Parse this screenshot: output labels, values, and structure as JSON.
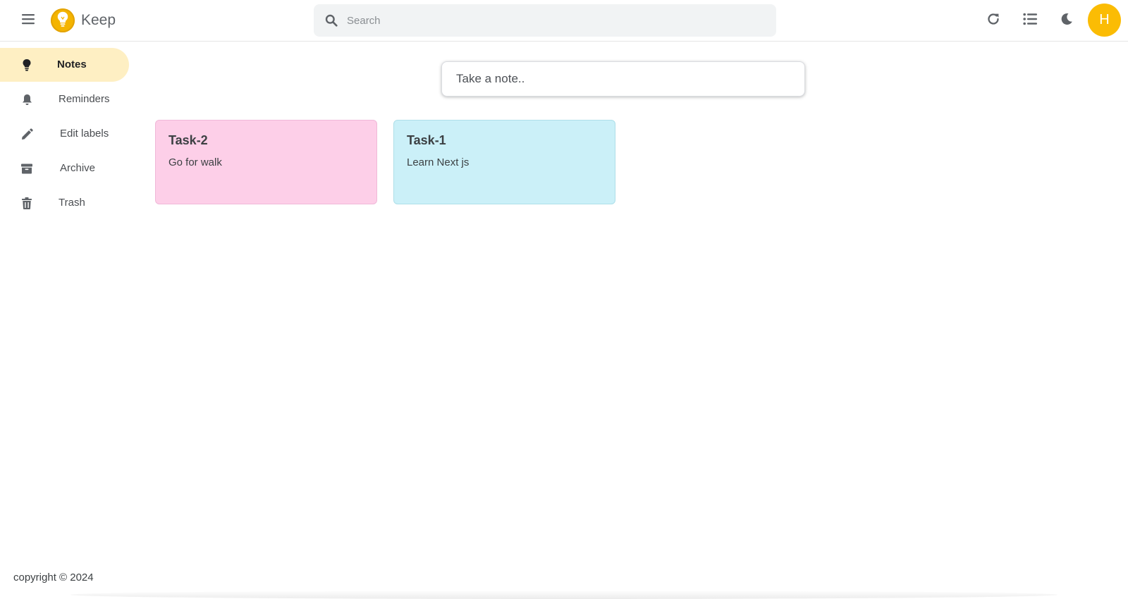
{
  "header": {
    "app_title": "Keep",
    "search_placeholder": "Search",
    "search_value": "",
    "avatar_initial": "H",
    "icons": [
      "hamburger-menu-icon",
      "bulb-logo-icon",
      "search-icon",
      "refresh-icon",
      "list-view-icon",
      "dark-mode-icon"
    ]
  },
  "sidebar": {
    "items": [
      {
        "label": "Notes",
        "icon": "bulb-icon",
        "active": true
      },
      {
        "label": "Reminders",
        "icon": "bell-icon",
        "active": false
      },
      {
        "label": "Edit labels",
        "icon": "pencil-icon",
        "active": false
      },
      {
        "label": "Archive",
        "icon": "archive-icon",
        "active": false
      },
      {
        "label": "Trash",
        "icon": "trash-icon",
        "active": false
      }
    ]
  },
  "composer": {
    "placeholder": "Take a note.."
  },
  "notes": [
    {
      "title": "Task-2",
      "body": "Go for walk",
      "color": "#fdcfe8",
      "border": "#f0b8d8"
    },
    {
      "title": "Task-1",
      "body": "Learn Next js",
      "color": "#cbf0f8",
      "border": "#aedfe9"
    }
  ],
  "footer": {
    "copyright": "copyright © 2024"
  },
  "colors": {
    "accent": "#fbbc04",
    "active_nav": "#feefc3",
    "search_bg": "#f1f3f4"
  }
}
